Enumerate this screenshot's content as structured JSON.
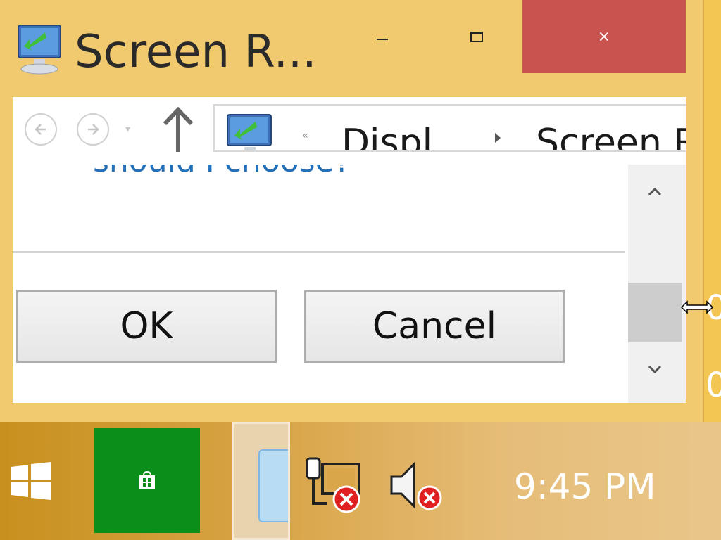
{
  "window": {
    "title": "Screen R...",
    "controls": {
      "minimize": "minimize",
      "maximize": "maximize",
      "close": "×"
    }
  },
  "nav": {
    "back_icon": "arrow-left-icon",
    "forward_icon": "arrow-right-icon",
    "up_icon": "arrow-up-icon",
    "address": {
      "chevron": "«",
      "segments": [
        "Displ...",
        "Screen R"
      ]
    }
  },
  "content": {
    "prompt_text": "should I choose?"
  },
  "buttons": {
    "ok": "OK",
    "cancel": "Cancel"
  },
  "desktop": {
    "digits": [
      "0",
      "0"
    ]
  },
  "taskbar": {
    "clock": "9:45 PM",
    "store_tile_color": "#0b8f1a",
    "tray": [
      "network-disconnected-icon",
      "volume-muted-icon"
    ]
  },
  "colors": {
    "window_frame": "#f1c96e",
    "close_button": "#c9534e",
    "link_text": "#2370b8"
  }
}
